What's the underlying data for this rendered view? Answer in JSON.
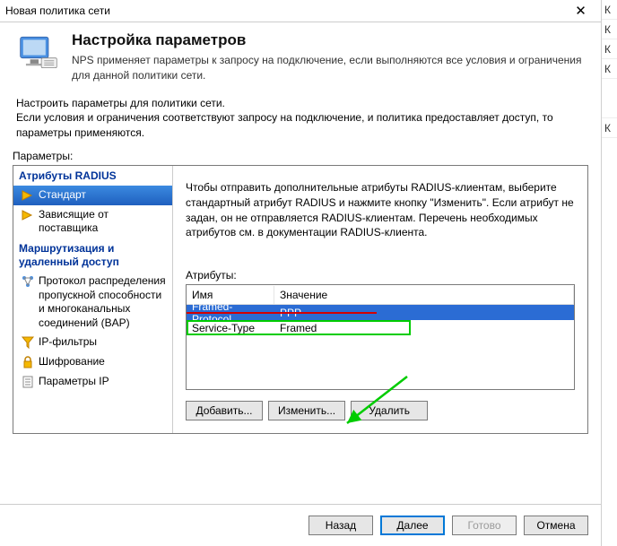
{
  "window": {
    "title": "Новая политика сети",
    "close": "✕"
  },
  "header": {
    "heading": "Настройка параметров",
    "desc": "NPS применяет параметры к запросу на подключение, если выполняются все условия и ограничения для данной политики сети."
  },
  "instructions": "Настроить параметры для политики сети.\nЕсли условия и ограничения соответствуют запросу на подключение, и политика предоставляет доступ, то параметры применяются.",
  "params_label": "Параметры:",
  "sidebar": {
    "group1_title": "Атрибуты RADIUS",
    "items1": [
      {
        "label": "Стандарт"
      },
      {
        "label": "Зависящие от поставщика"
      }
    ],
    "group2_title": "Маршрутизация и удаленный доступ",
    "items2": [
      {
        "label": "Протокол распределения пропускной способности и многоканальных соединений (BAP)"
      },
      {
        "label": "IP-фильтры"
      },
      {
        "label": "Шифрование"
      },
      {
        "label": "Параметры IP"
      }
    ]
  },
  "content": {
    "desc": "Чтобы отправить дополнительные атрибуты RADIUS-клиентам, выберите стандартный атрибут RADIUS и нажмите кнопку \"Изменить\". Если атрибут не задан, он не отправляется RADIUS-клиентам. Перечень необходимых атрибутов см. в документации RADIUS-клиента.",
    "attr_label": "Атрибуты:",
    "table": {
      "cols": {
        "name": "Имя",
        "value": "Значение"
      },
      "rows": [
        {
          "name": "Framed-Protocol",
          "value": "PPP"
        },
        {
          "name": "Service-Type",
          "value": "Framed"
        }
      ]
    },
    "buttons": {
      "add": "Добавить...",
      "edit": "Изменить...",
      "delete": "Удалить"
    }
  },
  "footer": {
    "back": "Назад",
    "next": "Далее",
    "finish": "Готово",
    "cancel": "Отмена"
  }
}
